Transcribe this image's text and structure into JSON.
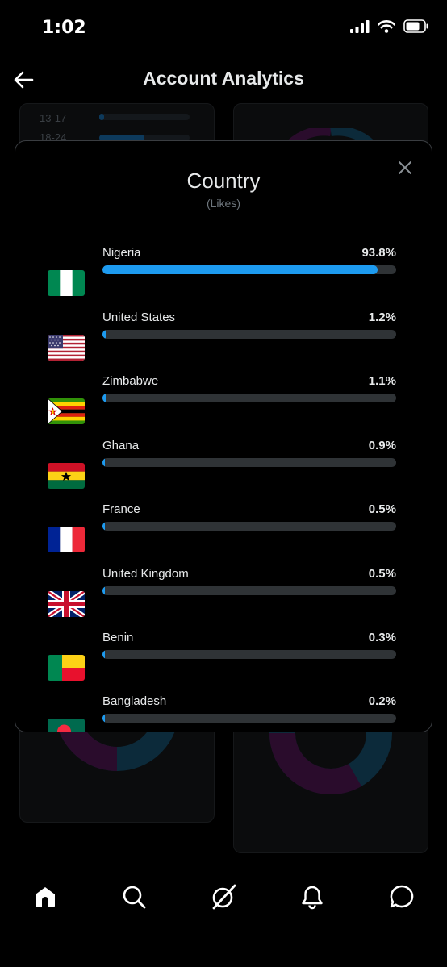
{
  "status": {
    "time": "1:02"
  },
  "header": {
    "title": "Account Analytics"
  },
  "background": {
    "age_labels": [
      "13-17",
      "18-24"
    ],
    "age_values": [
      0.05,
      0.5
    ]
  },
  "modal": {
    "title": "Country",
    "subtitle": "(Likes)",
    "countries": [
      {
        "name": "Nigeria",
        "percent": "93.8%",
        "value": 93.8,
        "flag_icon": "nigeria-flag-icon"
      },
      {
        "name": "United States",
        "percent": "1.2%",
        "value": 1.2,
        "flag_icon": "united-states-flag-icon"
      },
      {
        "name": "Zimbabwe",
        "percent": "1.1%",
        "value": 1.1,
        "flag_icon": "zimbabwe-flag-icon"
      },
      {
        "name": "Ghana",
        "percent": "0.9%",
        "value": 0.9,
        "flag_icon": "ghana-flag-icon"
      },
      {
        "name": "France",
        "percent": "0.5%",
        "value": 0.5,
        "flag_icon": "france-flag-icon"
      },
      {
        "name": "United Kingdom",
        "percent": "0.5%",
        "value": 0.5,
        "flag_icon": "united-kingdom-flag-icon"
      },
      {
        "name": "Benin",
        "percent": "0.3%",
        "value": 0.3,
        "flag_icon": "benin-flag-icon"
      },
      {
        "name": "Bangladesh",
        "percent": "0.2%",
        "value": 0.2,
        "flag_icon": "bangladesh-flag-icon"
      }
    ]
  },
  "nav": {
    "items": [
      "home-icon",
      "search-icon",
      "grok-icon",
      "notifications-icon",
      "messages-icon"
    ]
  },
  "colors": {
    "accent": "#1d9bf0",
    "track": "#2f3336",
    "background": "#000000",
    "modal_border": "#3a3d41"
  }
}
